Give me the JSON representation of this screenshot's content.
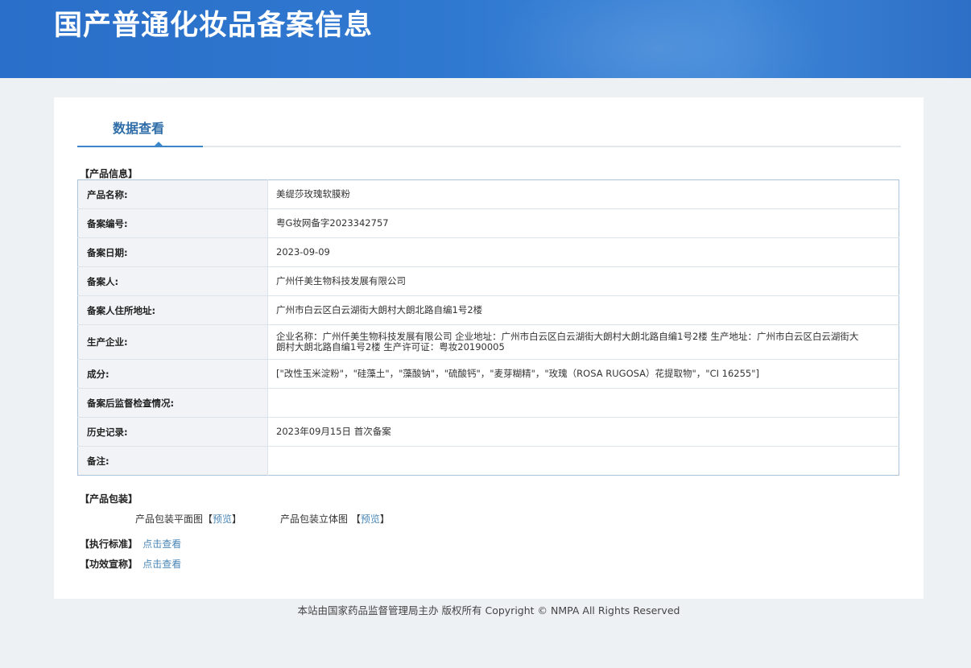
{
  "header": {
    "title": "国产普通化妆品备案信息"
  },
  "tabs": [
    {
      "label": "数据查看",
      "active": true
    }
  ],
  "product_info": {
    "section_title": "【产品信息】",
    "rows": [
      {
        "label": "产品名称:",
        "value": "美缇莎玫瑰软膜粉"
      },
      {
        "label": "备案编号:",
        "value": "粤G妆网备字2023342757"
      },
      {
        "label": "备案日期:",
        "value": "2023-09-09"
      },
      {
        "label": "备案人:",
        "value": "广州仟美生物科技发展有限公司"
      },
      {
        "label": "备案人住所地址:",
        "value": "广州市白云区白云湖街大朗村大朗北路自编1号2楼"
      },
      {
        "label": "生产企业:",
        "value": "企业名称：广州仟美生物科技发展有限公司 企业地址：广州市白云区白云湖街大朗村大朗北路自编1号2楼 生产地址：广州市白云区白云湖街大朗村大朗北路自编1号2楼 生产许可证：粤妆20190005"
      },
      {
        "label": "成分:",
        "value": "[\"改性玉米淀粉\"，\"硅藻土\"，\"藻酸钠\"，\"硫酸钙\"，\"麦芽糊精\"，\"玫瑰（ROSA RUGOSA）花提取物\"，\"CI 16255\"]"
      },
      {
        "label": "备案后监督检查情况:",
        "value": ""
      },
      {
        "label": "历史记录:",
        "value": "2023年09月15日 首次备案"
      },
      {
        "label": "备注:",
        "value": ""
      }
    ]
  },
  "packaging": {
    "section_title": "【产品包装】",
    "flat_label": "产品包装平面图",
    "solid_label": "产品包装立体图",
    "bracket_open": "【",
    "bracket_close": "】",
    "preview_link": "预览"
  },
  "standard": {
    "section_title": "【执行标准】",
    "link": "点击查看"
  },
  "efficacy": {
    "section_title": "【功效宣称】",
    "link": "点击查看"
  },
  "footer": {
    "text": "本站由国家药品监督管理局主办 版权所有 Copyright © NMPA All Rights Reserved"
  },
  "colors": {
    "header_bg": "#2f78d0",
    "tab_active": "#2f6da9",
    "link": "#4a86b5",
    "label_bg": "#f1f3f6"
  }
}
